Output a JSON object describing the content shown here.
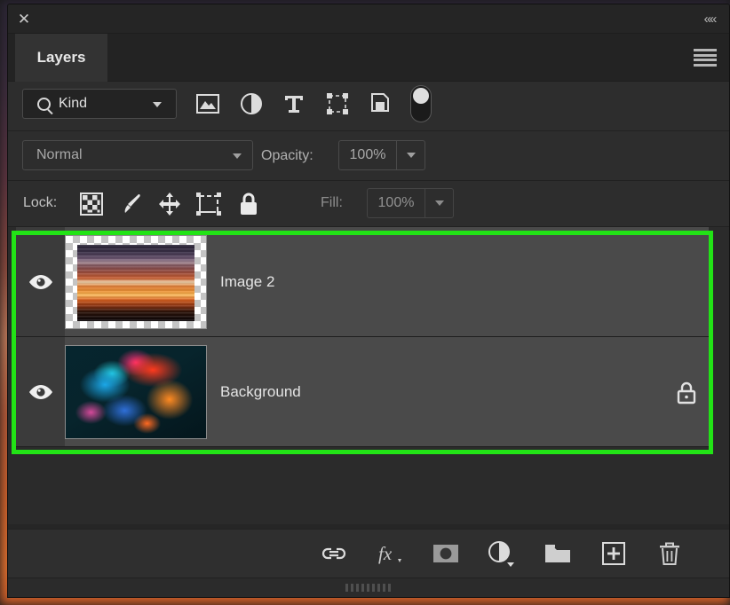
{
  "window": {
    "close_label": "✕",
    "collapse_label": "««"
  },
  "tabs": [
    {
      "label": "Layers",
      "active": true
    }
  ],
  "panel_menu": {
    "icon": "hamburger-menu-icon"
  },
  "filter_row": {
    "kind_label": "Kind",
    "search_icon": "search-icon",
    "filter_icons": [
      {
        "name": "pixel-layer-filter-icon",
        "title": "Filter for pixel layers"
      },
      {
        "name": "adjustment-layer-filter-icon",
        "title": "Filter for adjustment layers"
      },
      {
        "name": "type-layer-filter-icon",
        "title": "Filter for type layers"
      },
      {
        "name": "shape-layer-filter-icon",
        "title": "Filter for shape layers"
      },
      {
        "name": "smart-object-filter-icon",
        "title": "Filter for smart objects"
      }
    ],
    "toggle": {
      "name": "filter-toggle",
      "state": "on"
    }
  },
  "blend_row": {
    "blend_mode": "Normal",
    "opacity_label": "Opacity:",
    "opacity_value": "100%"
  },
  "lock_row": {
    "lock_label": "Lock:",
    "lock_icons": [
      {
        "name": "lock-transparent-pixels-icon"
      },
      {
        "name": "lock-image-pixels-icon"
      },
      {
        "name": "lock-position-icon"
      },
      {
        "name": "lock-artboard-nesting-icon"
      },
      {
        "name": "lock-all-icon"
      }
    ],
    "fill_label": "Fill:",
    "fill_value": "100%"
  },
  "layers": [
    {
      "name": "Image 2",
      "visible": true,
      "selected": true,
      "locked": false,
      "thumbnail": "sunset-stripes",
      "transparent": true
    },
    {
      "name": "Background",
      "visible": true,
      "selected": true,
      "locked": true,
      "thumbnail": "colorful-ink",
      "transparent": false
    }
  ],
  "selection_highlight_color": "#22e316",
  "bottom_toolbar": [
    {
      "name": "link-layers-button",
      "label": "Link layers"
    },
    {
      "name": "layer-style-button",
      "label": "fx"
    },
    {
      "name": "add-layer-mask-button",
      "label": "Add layer mask"
    },
    {
      "name": "new-adjustment-layer-button",
      "label": "New adjustment layer"
    },
    {
      "name": "new-group-button",
      "label": "New group"
    },
    {
      "name": "new-layer-button",
      "label": "New layer"
    },
    {
      "name": "delete-layer-button",
      "label": "Delete layer"
    }
  ]
}
